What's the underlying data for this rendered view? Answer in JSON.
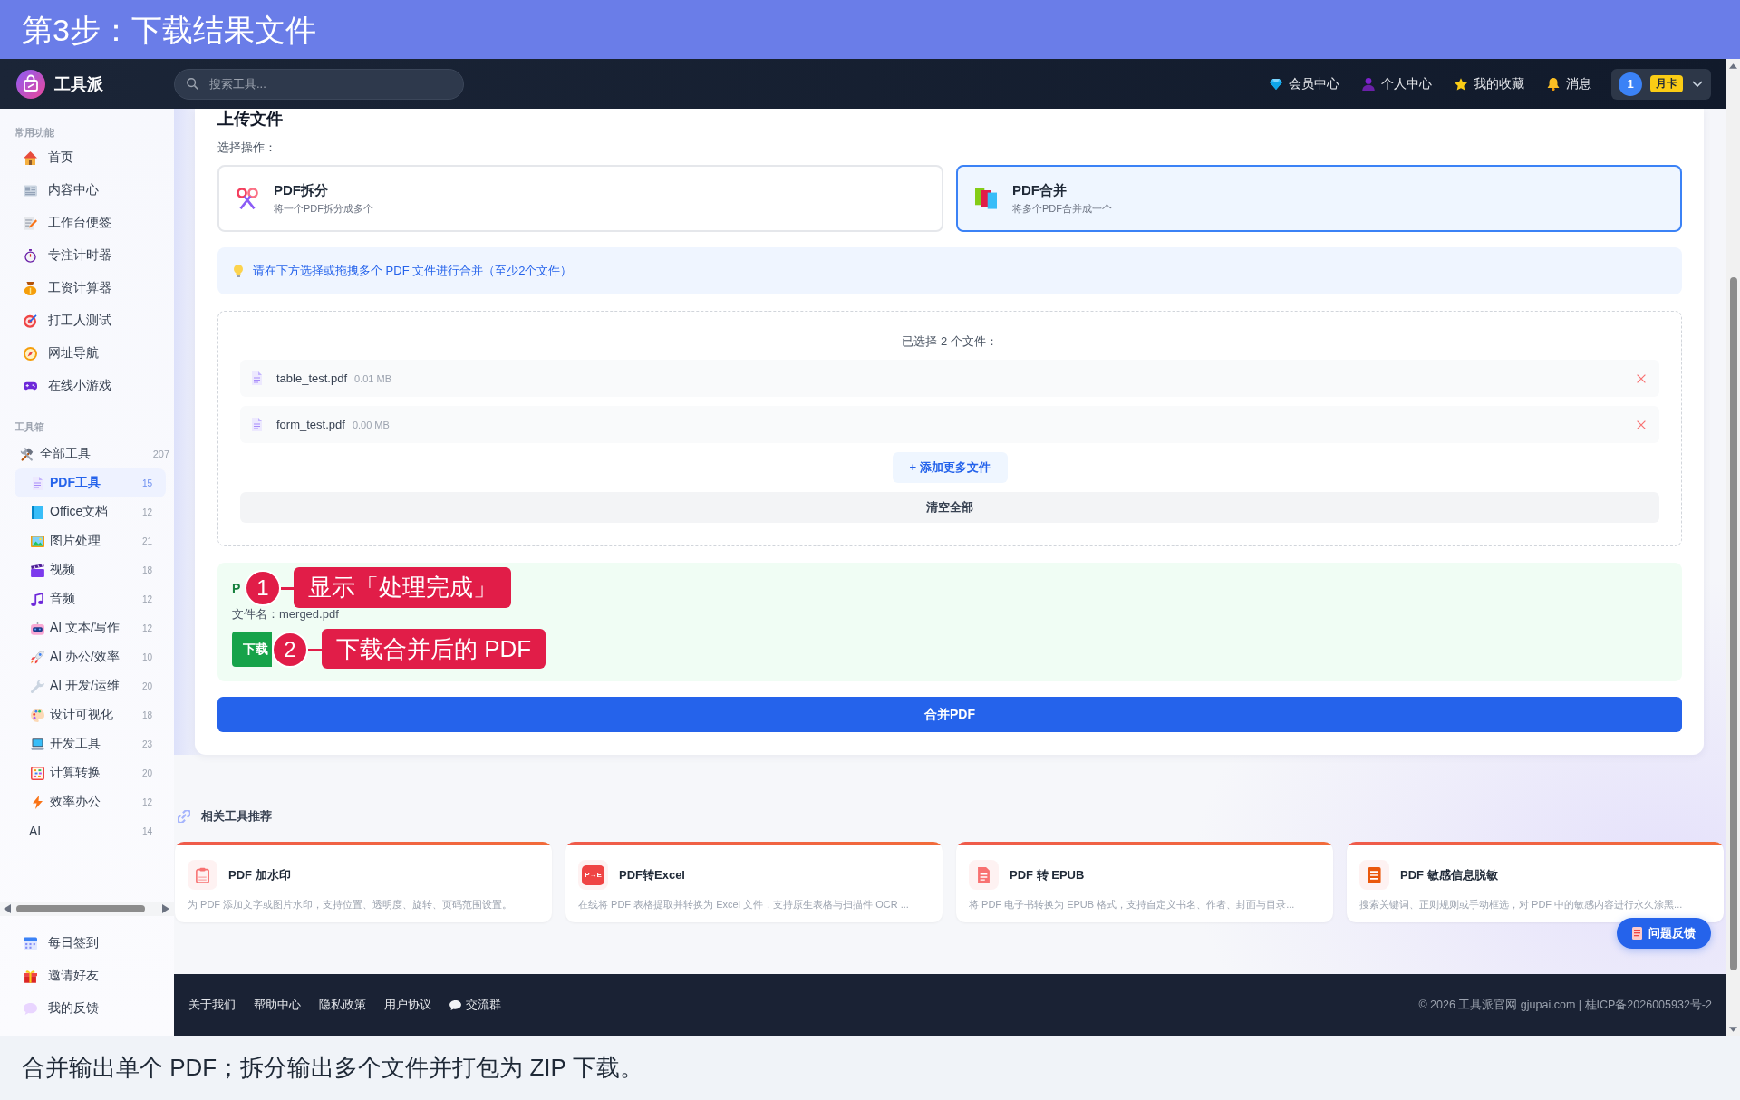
{
  "banner": {
    "title": "第3步：下载结果文件"
  },
  "header": {
    "logo_text": "工具派",
    "search": {
      "placeholder": "搜索工具..."
    },
    "nav": [
      {
        "label": "会员中心"
      },
      {
        "label": "个人中心"
      },
      {
        "label": "我的收藏"
      },
      {
        "label": "消息"
      }
    ],
    "user": {
      "avatar": "1",
      "badge": "月卡"
    }
  },
  "sidebar": {
    "sections": [
      {
        "title": "常用功能",
        "items": [
          {
            "label": "首页",
            "selected": false
          },
          {
            "label": "内容中心",
            "selected": false
          },
          {
            "label": "工作台便签",
            "selected": false
          },
          {
            "label": "专注计时器",
            "selected": false
          },
          {
            "label": "工资计算器",
            "selected": false
          },
          {
            "label": "打工人测试",
            "selected": false
          },
          {
            "label": "网址导航",
            "selected": false
          },
          {
            "label": "在线小游戏",
            "selected": false
          }
        ]
      },
      {
        "title": "工具箱",
        "items": [
          {
            "label": "全部工具",
            "count": "207",
            "selected": false,
            "children": [
              {
                "label": "PDF工具",
                "count": "15",
                "selected": true
              },
              {
                "label": "Office文档",
                "count": "12",
                "selected": false
              },
              {
                "label": "图片处理",
                "count": "21",
                "selected": false
              },
              {
                "label": "视频",
                "count": "18",
                "selected": false
              },
              {
                "label": "音频",
                "count": "12",
                "selected": false
              },
              {
                "label": "AI 文本/写作",
                "count": "12",
                "selected": false
              },
              {
                "label": "AI 办公/效率",
                "count": "10",
                "selected": false
              },
              {
                "label": "AI 开发/运维",
                "count": "20",
                "selected": false
              },
              {
                "label": "设计可视化",
                "count": "18",
                "selected": false
              },
              {
                "label": "开发工具",
                "count": "23",
                "selected": false
              },
              {
                "label": "计算转换",
                "count": "20",
                "selected": false
              },
              {
                "label": "效率办公",
                "count": "12",
                "selected": false
              },
              {
                "label": "AI",
                "count": "14",
                "selected": false
              }
            ]
          }
        ]
      }
    ],
    "bottom_items": [
      {
        "label": "每日签到",
        "selected": false
      },
      {
        "label": "邀请好友",
        "selected": false
      },
      {
        "label": "我的反馈",
        "selected": false
      }
    ]
  },
  "upload": {
    "title": "上传文件",
    "operation_label": "选择操作：",
    "operations": [
      {
        "name": "PDF拆分",
        "description": "将一个PDF拆分成多个",
        "selected": false
      },
      {
        "name": "PDF合并",
        "description": "将多个PDF合并成一个",
        "selected": true
      }
    ],
    "hint": "请在下方选择或拖拽多个 PDF 文件进行合并（至少2个文件）",
    "selected_count_label": "已选择 2 个文件：",
    "files": [
      {
        "name": "table_test.pdf",
        "size": "0.01 MB"
      },
      {
        "name": "form_test.pdf",
        "size": "0.00 MB"
      }
    ],
    "add_more_button": "+ 添加更多文件",
    "clear_all_button": "清空全部",
    "result": {
      "title": "P",
      "filename": "文件名：merged.pdf",
      "download_button": "下载"
    },
    "merge_button": "合并PDF"
  },
  "annotations": [
    {
      "number": "1",
      "text": "显示「处理完成」"
    },
    {
      "number": "2",
      "text": "下载合并后的 PDF"
    }
  ],
  "related": {
    "title": "相关工具推荐",
    "tools": [
      {
        "name": "PDF 加水印",
        "description": "为 PDF 添加文字或图片水印，支持位置、透明度、旋转、页码范围设置。"
      },
      {
        "name": "PDF转Excel",
        "description": "在线将 PDF 表格提取并转换为 Excel 文件，支持原生表格与扫描件 OCR ...",
        "icon_text": "P→E"
      },
      {
        "name": "PDF 转 EPUB",
        "description": "将 PDF 电子书转换为 EPUB 格式，支持自定义书名、作者、封面与目录..."
      },
      {
        "name": "PDF 敏感信息脱敏",
        "description": "搜索关键词、正则规则或手动框选，对 PDF 中的敏感内容进行永久涂黑..."
      }
    ]
  },
  "feedback_button": "问题反馈",
  "footer": {
    "links": [
      {
        "label": "关于我们"
      },
      {
        "label": "帮助中心"
      },
      {
        "label": "隐私政策"
      },
      {
        "label": "用户协议"
      },
      {
        "label": "交流群"
      }
    ],
    "copyright": "© 2026 工具派官网 gjupai.com | 桂ICP备2026005932号-2"
  },
  "caption": "合并输出单个 PDF；拆分输出多个文件并打包为 ZIP 下载。"
}
